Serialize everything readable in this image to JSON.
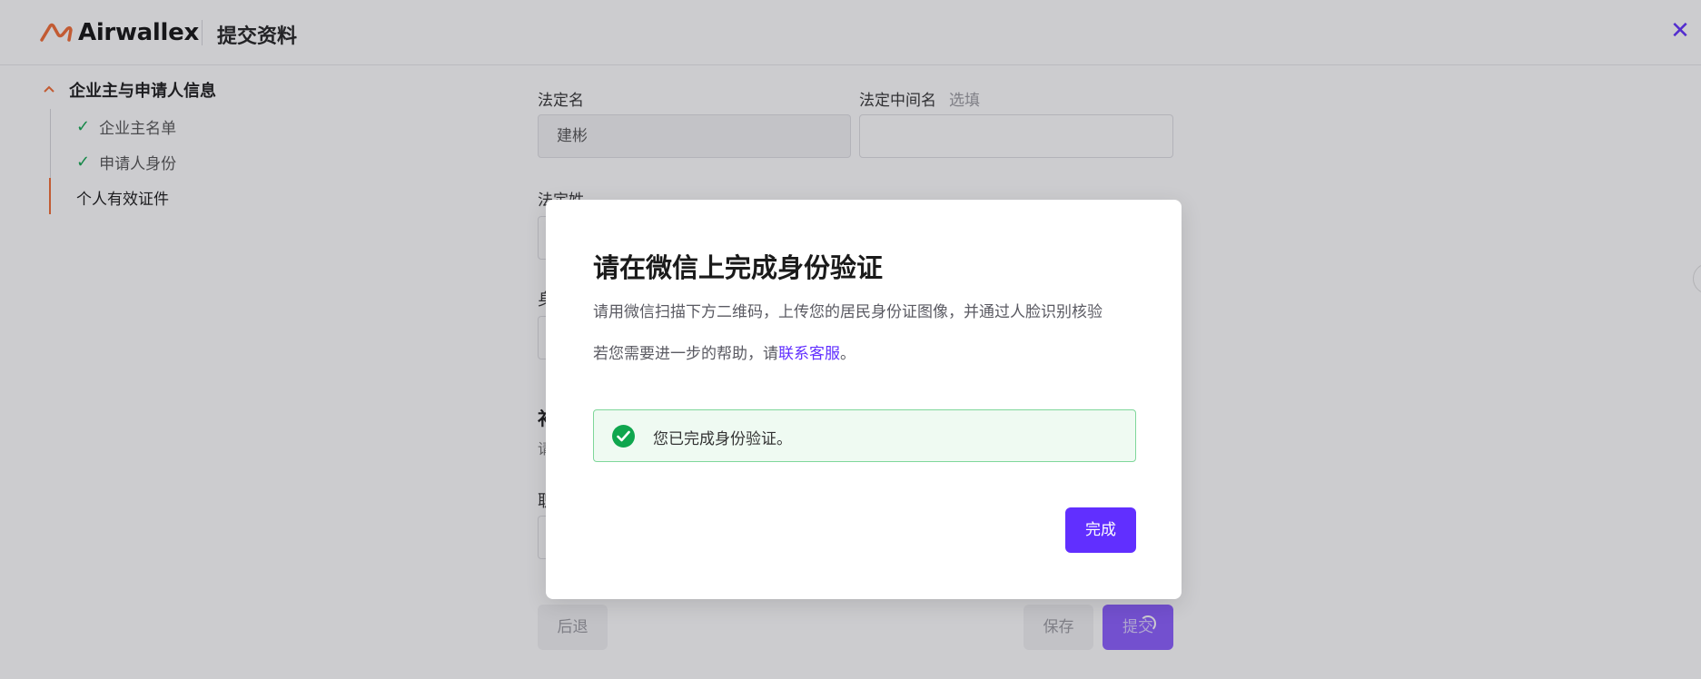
{
  "header": {
    "brand": "Airwallex",
    "title": "提交资料",
    "close_glyph": "✕"
  },
  "sidebar": {
    "section_title": "企业主与申请人信息",
    "items": [
      {
        "label": "企业主名单",
        "status": "done"
      },
      {
        "label": "申请人身份",
        "status": "done"
      },
      {
        "label": "个人有效证件",
        "status": "current"
      }
    ]
  },
  "form": {
    "legal_first_name_label": "法定名",
    "legal_first_name_value": "建彬",
    "legal_middle_name_label": "法定中间名",
    "legal_middle_name_optional": "选填",
    "legal_last_name_label": "法定姓",
    "partial_labels": [
      "身",
      "补",
      "请",
      "职"
    ]
  },
  "footer": {
    "back_label": "后退",
    "save_label": "保存",
    "submit_label": "提交"
  },
  "modal": {
    "title": "请在微信上完成身份验证",
    "description": "请用微信扫描下方二维码，上传您的居民身份证图像，并通过人脸识别核验",
    "help_prefix": "若您需要进一步的帮助，请",
    "help_link": "联系客服",
    "help_suffix": "。",
    "success_message": "您已完成身份验证。",
    "done_label": "完成"
  },
  "colors": {
    "accent": "#612fff",
    "brand_orange": "#f26b32",
    "success": "#0fa64e"
  },
  "icons": [
    "airwallex-logo-icon",
    "close-icon",
    "chevron-up-icon",
    "check-icon",
    "success-check-icon",
    "loading-spinner-icon"
  ]
}
